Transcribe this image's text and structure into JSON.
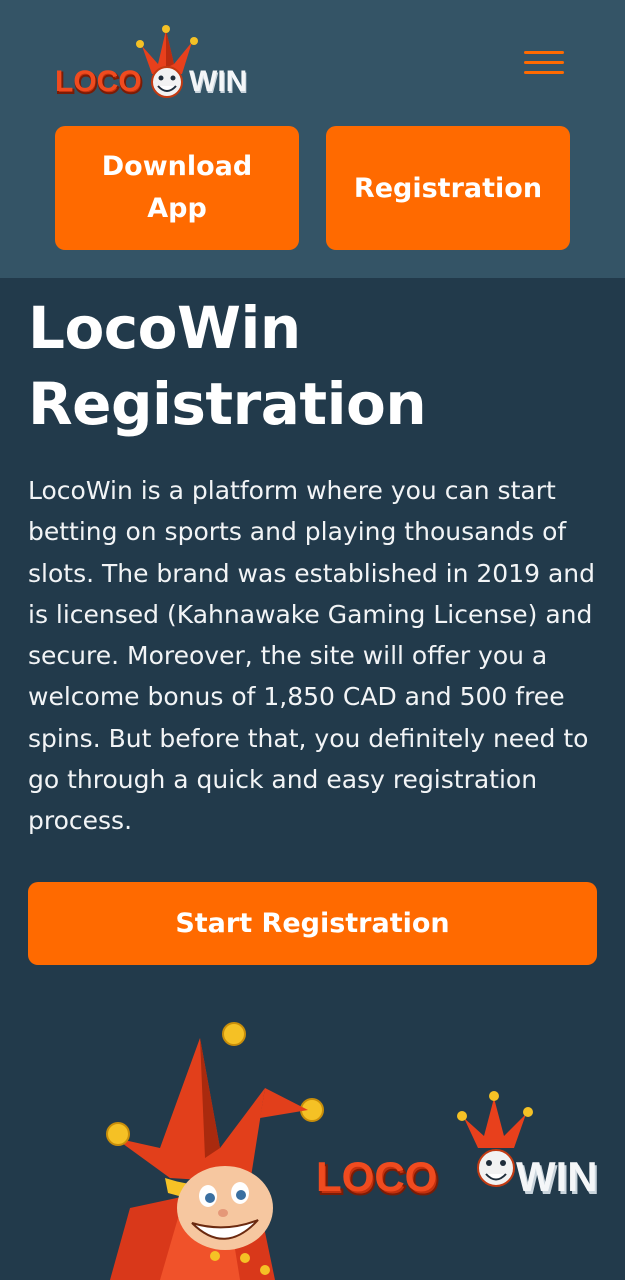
{
  "header": {
    "logo_text": "LOCOWIN",
    "download_label": "Download App",
    "register_label": "Registration"
  },
  "main": {
    "title": "LocoWin Registration",
    "intro": "LocoWin is a platform where you can start betting on sports and playing thousands of slots. The brand was established in 2019 and is licensed (Kahnawake Gaming License) and secure. Moreover, the site will offer you a welcome bonus of 1,850 CAD and 500 free spins. But before that, you definitely need to go through a quick and easy registration process.",
    "start_label": "Start Registration"
  },
  "colors": {
    "header_bg": "#345466",
    "page_bg": "#223a4b",
    "accent": "#ff6a00"
  }
}
